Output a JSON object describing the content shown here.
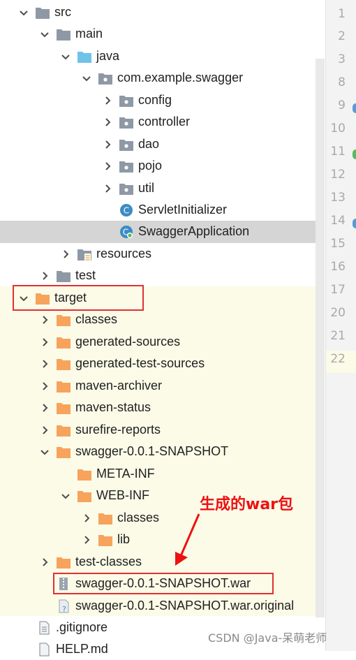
{
  "tree": {
    "src": "src",
    "main": "main",
    "java": "java",
    "package": "com.example.swagger",
    "config": "config",
    "controller": "controller",
    "dao": "dao",
    "pojo": "pojo",
    "util": "util",
    "servlet_initializer": "ServletInitializer",
    "swagger_application": "SwaggerApplication",
    "resources": "resources",
    "test": "test",
    "target": "target",
    "classes": "classes",
    "generated_sources": "generated-sources",
    "generated_test_sources": "generated-test-sources",
    "maven_archiver": "maven-archiver",
    "maven_status": "maven-status",
    "surefire_reports": "surefire-reports",
    "snapshot_dir": "swagger-0.0.1-SNAPSHOT",
    "meta_inf": "META-INF",
    "web_inf": "WEB-INF",
    "web_inf_classes": "classes",
    "web_inf_lib": "lib",
    "test_classes": "test-classes",
    "war_file": "swagger-0.0.1-SNAPSHOT.war",
    "war_original": "swagger-0.0.1-SNAPSHOT.war.original",
    "gitignore": ".gitignore",
    "help_md": "HELP.md"
  },
  "gutter_lines": [
    "1",
    "2",
    "3",
    "8",
    "9",
    "10",
    "11",
    "12",
    "13",
    "14",
    "15",
    "16",
    "17",
    "20",
    "21",
    "22"
  ],
  "annotation": "生成的war包",
  "watermark": "CSDN @Java-呆萌老师",
  "colors": {
    "folder": "#8f99a5",
    "folder_orange": "#f7a35c",
    "java_folder": "#6fc3e7",
    "class_icon": "#3c8cc4",
    "red": "#e03131"
  }
}
